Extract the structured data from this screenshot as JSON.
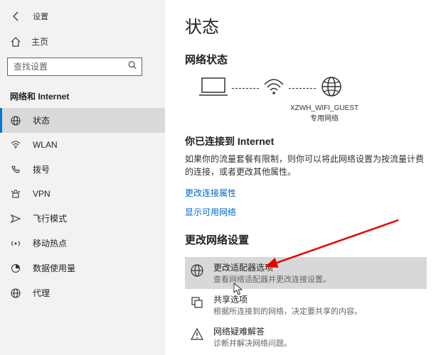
{
  "header": {
    "title": "设置"
  },
  "home": {
    "label": "主页"
  },
  "search": {
    "placeholder": "查找设置"
  },
  "section": {
    "title": "网络和 Internet"
  },
  "nav": [
    {
      "label": "状态"
    },
    {
      "label": "WLAN"
    },
    {
      "label": "拨号"
    },
    {
      "label": "VPN"
    },
    {
      "label": "飞行模式"
    },
    {
      "label": "移动热点"
    },
    {
      "label": "数据使用量"
    },
    {
      "label": "代理"
    }
  ],
  "page": {
    "title": "状态"
  },
  "status": {
    "heading": "网络状态",
    "conn_name": "XZWH_WIFI_GUEST",
    "conn_type": "专用网络",
    "connected_h": "你已连接到 Internet",
    "connected_body": "如果你的流量套餐有限制，则你可以将此网络设置为按流量计费的连接，或者更改其他属性。",
    "link1": "更改连接属性",
    "link2": "显示可用网络"
  },
  "change": {
    "heading": "更改网络设置",
    "opt1_t": "更改适配器选项",
    "opt1_d": "查看网络适配器并更改连接设置。",
    "opt2_t": "共享选项",
    "opt2_d": "根据所连接到的网络，决定要共享的内容。",
    "opt3_t": "网络疑难解答",
    "opt3_d": "诊断并解决网络问题。"
  }
}
